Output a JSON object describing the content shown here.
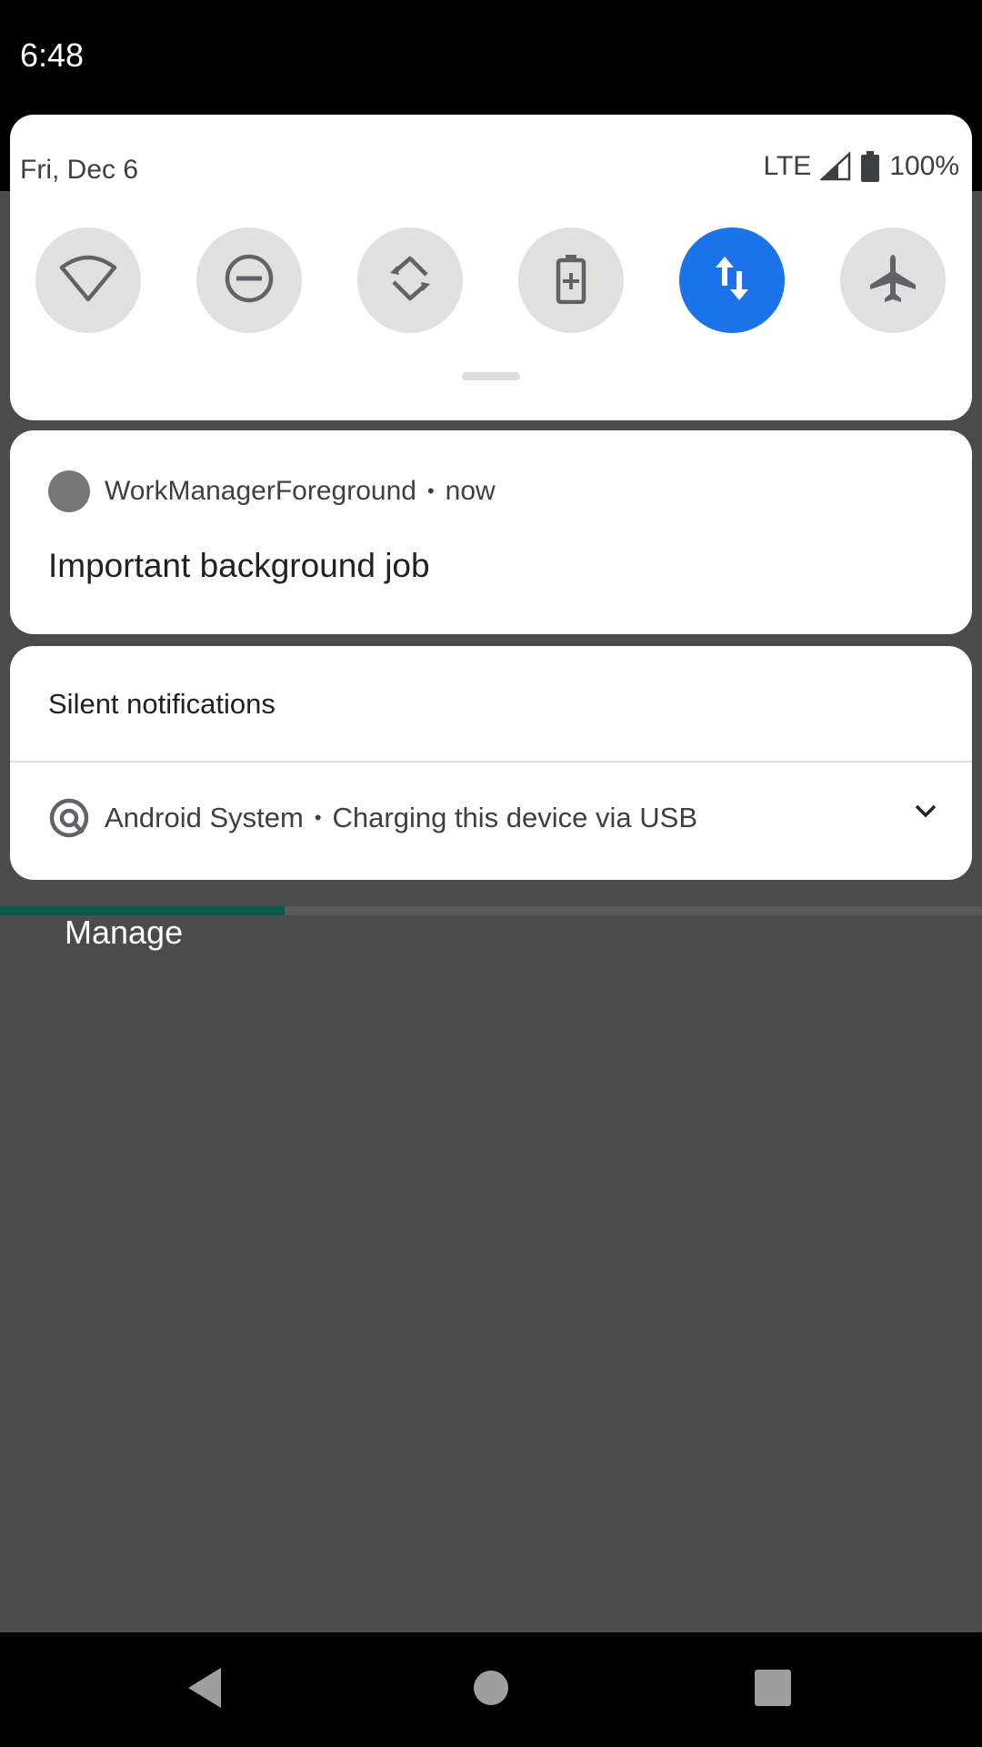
{
  "status_bar": {
    "time": "6:48"
  },
  "quick_settings": {
    "date": "Fri, Dec 6",
    "network": "LTE",
    "battery": "100%",
    "tiles": [
      {
        "icon": "wifi-icon",
        "active": false
      },
      {
        "icon": "do-not-disturb-icon",
        "active": false
      },
      {
        "icon": "auto-rotate-icon",
        "active": false
      },
      {
        "icon": "battery-saver-icon",
        "active": false
      },
      {
        "icon": "mobile-data-icon",
        "active": true
      },
      {
        "icon": "airplane-mode-icon",
        "active": false
      }
    ],
    "active_color": "#1a73e8"
  },
  "notification": {
    "app_name": "WorkManagerForeground",
    "separator": "•",
    "time": "now",
    "title": "Important background job"
  },
  "silent_section": {
    "header": "Silent notifications",
    "app_name": "Android System",
    "separator": "•",
    "text": "Charging this device via USB"
  },
  "progress": {
    "fraction": 0.29,
    "color": "#0b5b4d"
  },
  "manage_label": "Manage"
}
